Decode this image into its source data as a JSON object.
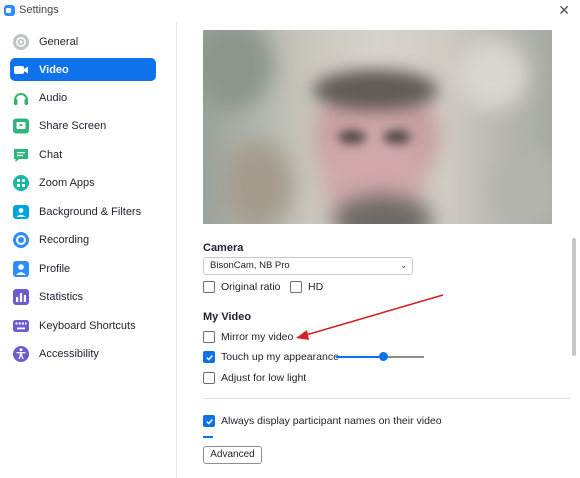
{
  "window": {
    "title": "Settings",
    "close_glyph": "✕"
  },
  "sidebar": {
    "items": [
      {
        "label": "General",
        "icon": "gear-icon",
        "color": "#bfc3c8"
      },
      {
        "label": "Video",
        "icon": "video-camera-icon",
        "color": "#ffffff",
        "active": true
      },
      {
        "label": "Audio",
        "icon": "headphones-icon",
        "color": "#32b56a"
      },
      {
        "label": "Share Screen",
        "icon": "share-screen-icon",
        "color": "#2eb67d"
      },
      {
        "label": "Chat",
        "icon": "chat-bubble-icon",
        "color": "#2eb67d"
      },
      {
        "label": "Zoom Apps",
        "icon": "zoom-apps-icon",
        "color": "#19b5a6"
      },
      {
        "label": "Background & Filters",
        "icon": "person-card-icon",
        "color": "#00a3e0"
      },
      {
        "label": "Recording",
        "icon": "recording-icon",
        "color": "#2d8cff"
      },
      {
        "label": "Profile",
        "icon": "profile-icon",
        "color": "#2d8cff"
      },
      {
        "label": "Statistics",
        "icon": "bar-chart-icon",
        "color": "#6d5bd0"
      },
      {
        "label": "Keyboard Shortcuts",
        "icon": "keyboard-icon",
        "color": "#6d5bd0"
      },
      {
        "label": "Accessibility",
        "icon": "accessibility-icon",
        "color": "#6d5bd0"
      }
    ]
  },
  "camera": {
    "heading": "Camera",
    "selected": "BisonCam, NB Pro",
    "original_ratio": {
      "label": "Original ratio",
      "checked": false
    },
    "hd": {
      "label": "HD",
      "checked": false
    }
  },
  "my_video": {
    "heading": "My Video",
    "mirror": {
      "label": "Mirror my video",
      "checked": false
    },
    "touch_up": {
      "label": "Touch up my appearance",
      "checked": true,
      "slider_level": 0.53
    },
    "low_light": {
      "label": "Adjust for low light",
      "checked": false
    }
  },
  "participant_names": {
    "label": "Always display participant names on their video",
    "checked": true
  },
  "advanced_button": "Advanced",
  "colors": {
    "accent": "#0e72ed",
    "annotation_arrow": "#d32222"
  }
}
